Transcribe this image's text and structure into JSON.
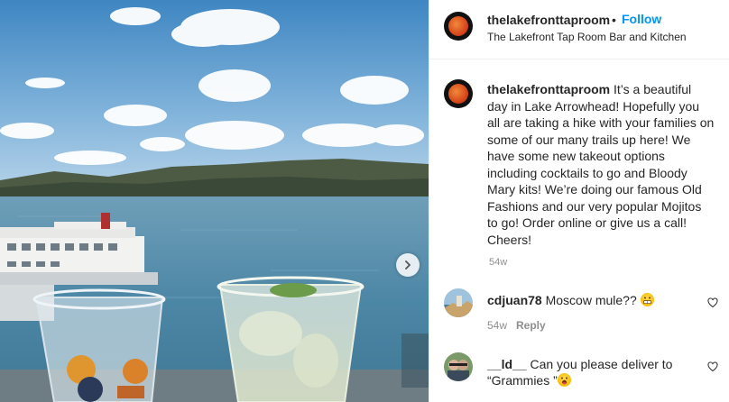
{
  "post": {
    "photo_description_icon": "lake-photo-icon",
    "next_icon": "chevron-right-icon"
  },
  "header": {
    "username": "thelakefronttaproom",
    "separator": "•",
    "follow_label": "Follow",
    "location": "The Lakefront Tap Room Bar and Kitchen"
  },
  "caption": {
    "username": "thelakefronttaproom",
    "text": " It’s a beautiful day in Lake Arrowhead! Hopefully you all are taking a hike with your families on some of our many trails up here! We have some new takeout options including cocktails to go and Bloody Mary kits! We’re doing our famous Old Fashions and our very popular Mojitos to go! Order online or give us a call! Cheers!",
    "time": "54w"
  },
  "comments": [
    {
      "username": "cdjuan78",
      "text": " Moscow mule?? ",
      "emoji": "grimacing-face",
      "time": "54w",
      "reply_label": "Reply",
      "icon": "heart-icon"
    },
    {
      "username": "__ld__",
      "text": " Can you please deliver to “Grammies ”",
      "emoji": "face-with-tongue",
      "icon": "heart-icon"
    }
  ],
  "colors": {
    "accent": "#0095f6",
    "text": "#262626",
    "muted": "#8e8e8e"
  }
}
